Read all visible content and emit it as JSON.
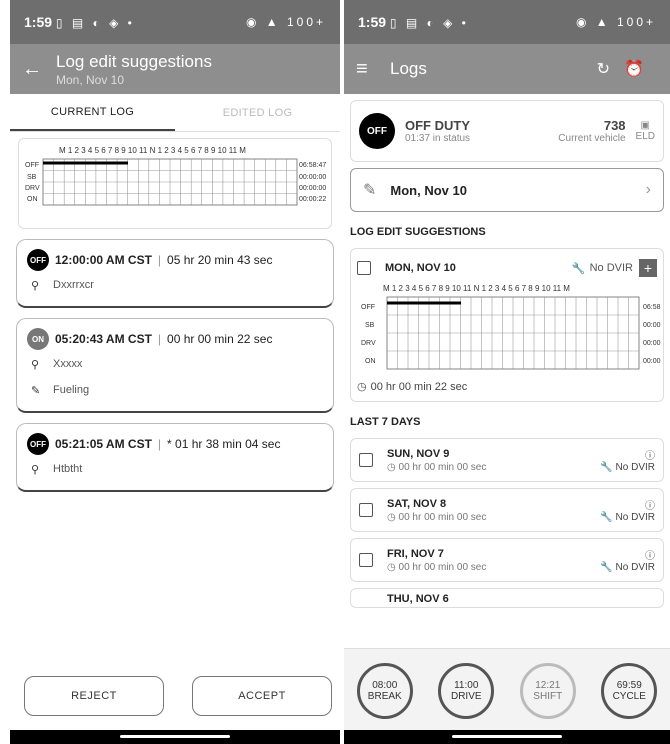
{
  "left": {
    "status": {
      "time": "1:59",
      "icons": "▯ ▤ ◐ ◈ •",
      "right": "◉ ▲ 100+"
    },
    "appbar": {
      "back": "←",
      "title": "Log edit suggestions",
      "subtitle": "Mon, Nov 10"
    },
    "tabs": [
      "CURRENT LOG",
      "EDITED LOG"
    ],
    "graph": {
      "hours": "M 1 2 3 4 5 6 7 8 9 10 11 N 1 2 3 4 5 6 7 8 9 10 11 M",
      "rows": [
        "OFF",
        "SB",
        "DRV",
        "ON"
      ],
      "totals": [
        "06:58:47",
        "00:00:00",
        "00:00:00",
        "00:00:22"
      ]
    },
    "entries": [
      {
        "badge": "OFF",
        "time": "12:00:00 AM CST",
        "duration": "05 hr  20 min  43 sec",
        "location": "Dxxrrxcr"
      },
      {
        "badge": "ON",
        "time": "05:20:43 AM CST",
        "duration": "00 hr  00 min  22 sec",
        "location": "Xxxxx",
        "note": "Fueling"
      },
      {
        "badge": "OFF",
        "time": "05:21:05 AM CST",
        "duration": "* 01 hr  38 min  04 sec",
        "location": "Htbtht"
      }
    ],
    "buttons": {
      "reject": "REJECT",
      "accept": "ACCEPT"
    }
  },
  "right": {
    "status": {
      "time": "1:59",
      "icons": "▯ ▤ ◐ ◈ •",
      "right": "◉ ▲ 100+"
    },
    "appbar": {
      "title": "Logs"
    },
    "duty": {
      "badge": "OFF",
      "title": "OFF DUTY",
      "sub": "01:37 in status",
      "vehicle": "738",
      "vehicle_label": "Current vehicle",
      "eld": "ELD"
    },
    "date_row": "Mon, Nov 10",
    "section1": "LOG EDIT SUGGESTIONS",
    "suggestion": {
      "date": "MON, NOV 10",
      "dvir": "No DVIR",
      "duration": "00 hr  00 min  22 sec",
      "graph": {
        "hours": "M 1 2 3 4 5 6 7 8 9 10 11 N 1 2 3 4 5 6 7 8 9 10 11 M",
        "rows": [
          "OFF",
          "SB",
          "DRV",
          "ON"
        ],
        "totals": [
          "06:58",
          "00:00",
          "00:00",
          "00:00"
        ]
      }
    },
    "section2": "LAST 7 DAYS",
    "days": [
      {
        "date": "SUN, NOV 9",
        "duration": "00 hr  00 min  00 sec",
        "dvir": "No DVIR"
      },
      {
        "date": "SAT, NOV 8",
        "duration": "00 hr  00 min  00 sec",
        "dvir": "No DVIR"
      },
      {
        "date": "FRI, NOV 7",
        "duration": "00 hr  00 min  00 sec",
        "dvir": "No DVIR"
      },
      {
        "date": "THU, NOV 6"
      }
    ],
    "dials": [
      {
        "time": "08:00",
        "label": "BREAK"
      },
      {
        "time": "11:00",
        "label": "DRIVE"
      },
      {
        "time": "12:21",
        "label": "SHIFT"
      },
      {
        "time": "69:59",
        "label": "CYCLE"
      }
    ]
  }
}
